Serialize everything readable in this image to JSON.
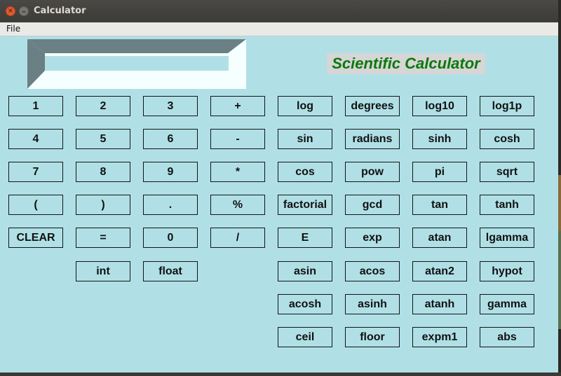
{
  "window": {
    "title": "Calculator"
  },
  "menu": {
    "file": "File"
  },
  "display": {
    "value": ""
  },
  "app_title": "Scientific Calculator",
  "buttons": {
    "row1": [
      "1",
      "2",
      "3",
      "+",
      "log",
      "degrees",
      "log10",
      "log1p"
    ],
    "row2": [
      "4",
      "5",
      "6",
      "-",
      "sin",
      "radians",
      "sinh",
      "cosh"
    ],
    "row3": [
      "7",
      "8",
      "9",
      "*",
      "cos",
      "pow",
      "pi",
      "sqrt"
    ],
    "row4": [
      "(",
      ")",
      ".",
      "%",
      "factorial",
      "gcd",
      "tan",
      "tanh"
    ],
    "row5": [
      "CLEAR",
      "=",
      "0",
      "/",
      "E",
      "exp",
      "atan",
      "lgamma"
    ],
    "row6": [
      "int",
      "float",
      "asin",
      "acos",
      "atan2",
      "hypot"
    ],
    "row7": [
      "acosh",
      "asinh",
      "atanh",
      "gamma"
    ],
    "row8": [
      "ceil",
      "floor",
      "expm1",
      "abs"
    ]
  },
  "colors": {
    "background": "#b0e0e6",
    "title_text": "#0d780d",
    "title_bg": "#d6d6d6",
    "titlebar": "#3c3b37",
    "close_button": "#e25a2d"
  }
}
